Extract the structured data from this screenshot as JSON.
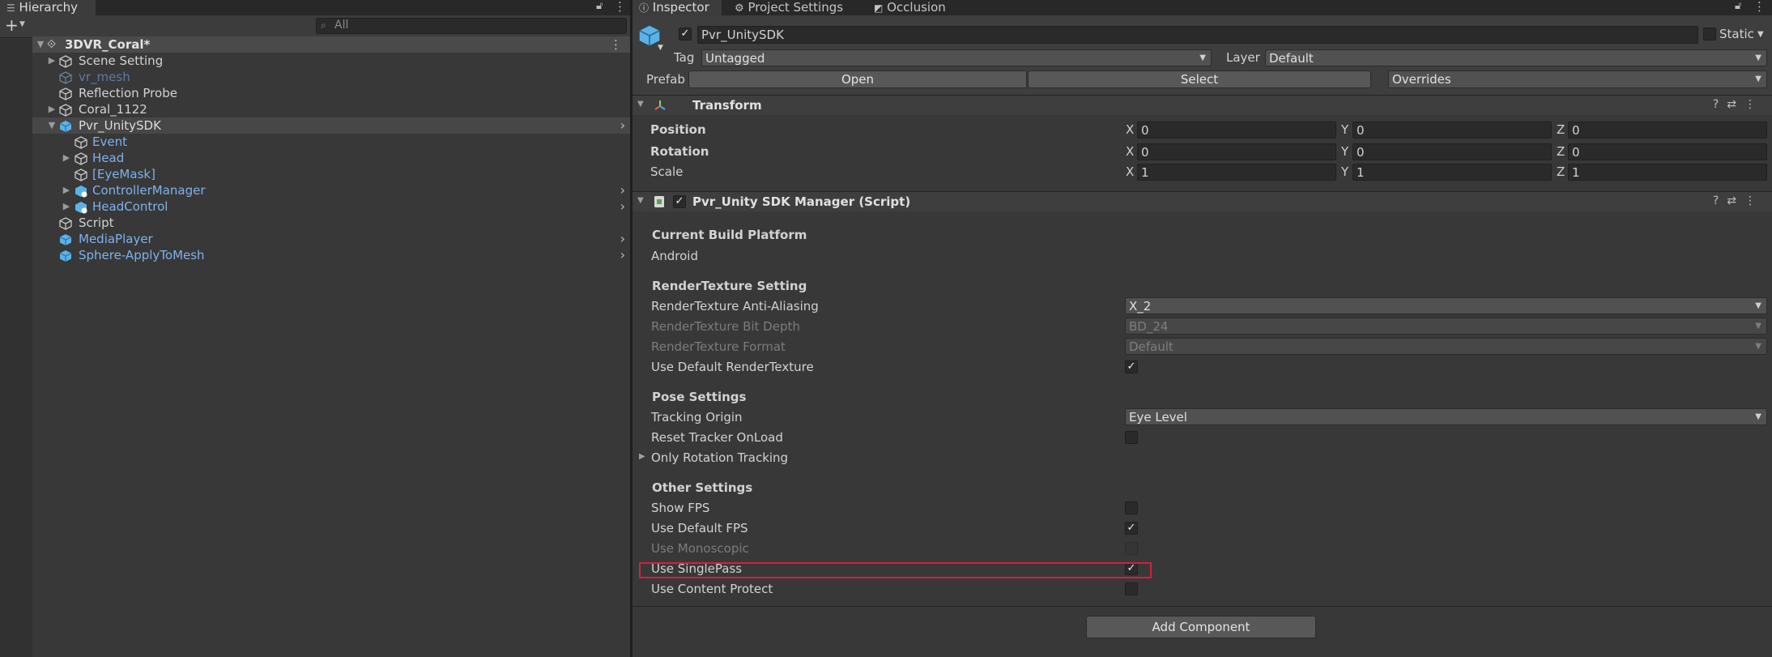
{
  "hierarchy": {
    "tab_label": "Hierarchy",
    "add_label": "+",
    "search_placeholder": "All",
    "scene_name": "3DVR_Coral*",
    "items": [
      {
        "label": "Scene Setting"
      },
      {
        "label": "vr_mesh"
      },
      {
        "label": "Reflection Probe"
      },
      {
        "label": "Coral_1122"
      },
      {
        "label": "Pvr_UnitySDK"
      },
      {
        "label": "Event"
      },
      {
        "label": "Head"
      },
      {
        "label": "[EyeMask]"
      },
      {
        "label": "ControllerManager"
      },
      {
        "label": "HeadControl"
      },
      {
        "label": "Script"
      },
      {
        "label": "MediaPlayer"
      },
      {
        "label": "Sphere-ApplyToMesh"
      }
    ]
  },
  "inspector": {
    "tabs": [
      {
        "label": "Inspector"
      },
      {
        "label": "Project Settings"
      },
      {
        "label": "Occlusion"
      }
    ],
    "object_name": "Pvr_UnitySDK",
    "static_label": "Static",
    "tag_label": "Tag",
    "tag_value": "Untagged",
    "layer_label": "Layer",
    "layer_value": "Default",
    "prefab_label": "Prefab",
    "prefab_open": "Open",
    "prefab_select": "Select",
    "prefab_overrides": "Overrides",
    "transform": {
      "title": "Transform",
      "position_label": "Position",
      "rotation_label": "Rotation",
      "scale_label": "Scale",
      "x": "X",
      "y": "Y",
      "z": "Z",
      "position": [
        "0",
        "0",
        "0"
      ],
      "rotation": [
        "0",
        "0",
        "0"
      ],
      "scale": [
        "1",
        "1",
        "1"
      ]
    },
    "script": {
      "title": "Pvr_Unity SDK Manager (Script)",
      "current_build_platform": "Current Build Platform",
      "platform": "Android",
      "rt_setting": "RenderTexture Setting",
      "rt_aa_label": "RenderTexture Anti-Aliasing",
      "rt_aa_value": "X_2",
      "rt_depth_label": "RenderTexture Bit Depth",
      "rt_depth_value": "BD_24",
      "rt_format_label": "RenderTexture Format",
      "rt_format_value": "Default",
      "use_default_rt_label": "Use Default RenderTexture",
      "pose_settings": "Pose Settings",
      "tracking_origin_label": "Tracking Origin",
      "tracking_origin_value": "Eye Level",
      "reset_tracker_label": "Reset Tracker OnLoad",
      "only_rotation_label": "Only Rotation Tracking",
      "other_settings": "Other Settings",
      "show_fps_label": "Show FPS",
      "use_default_fps_label": "Use Default FPS",
      "use_monoscopic_label": "Use Monoscopic",
      "use_singlepass_label": "Use SinglePass",
      "use_content_protect_label": "Use Content Protect",
      "check_mark": "✓"
    },
    "add_component": "Add Component"
  }
}
